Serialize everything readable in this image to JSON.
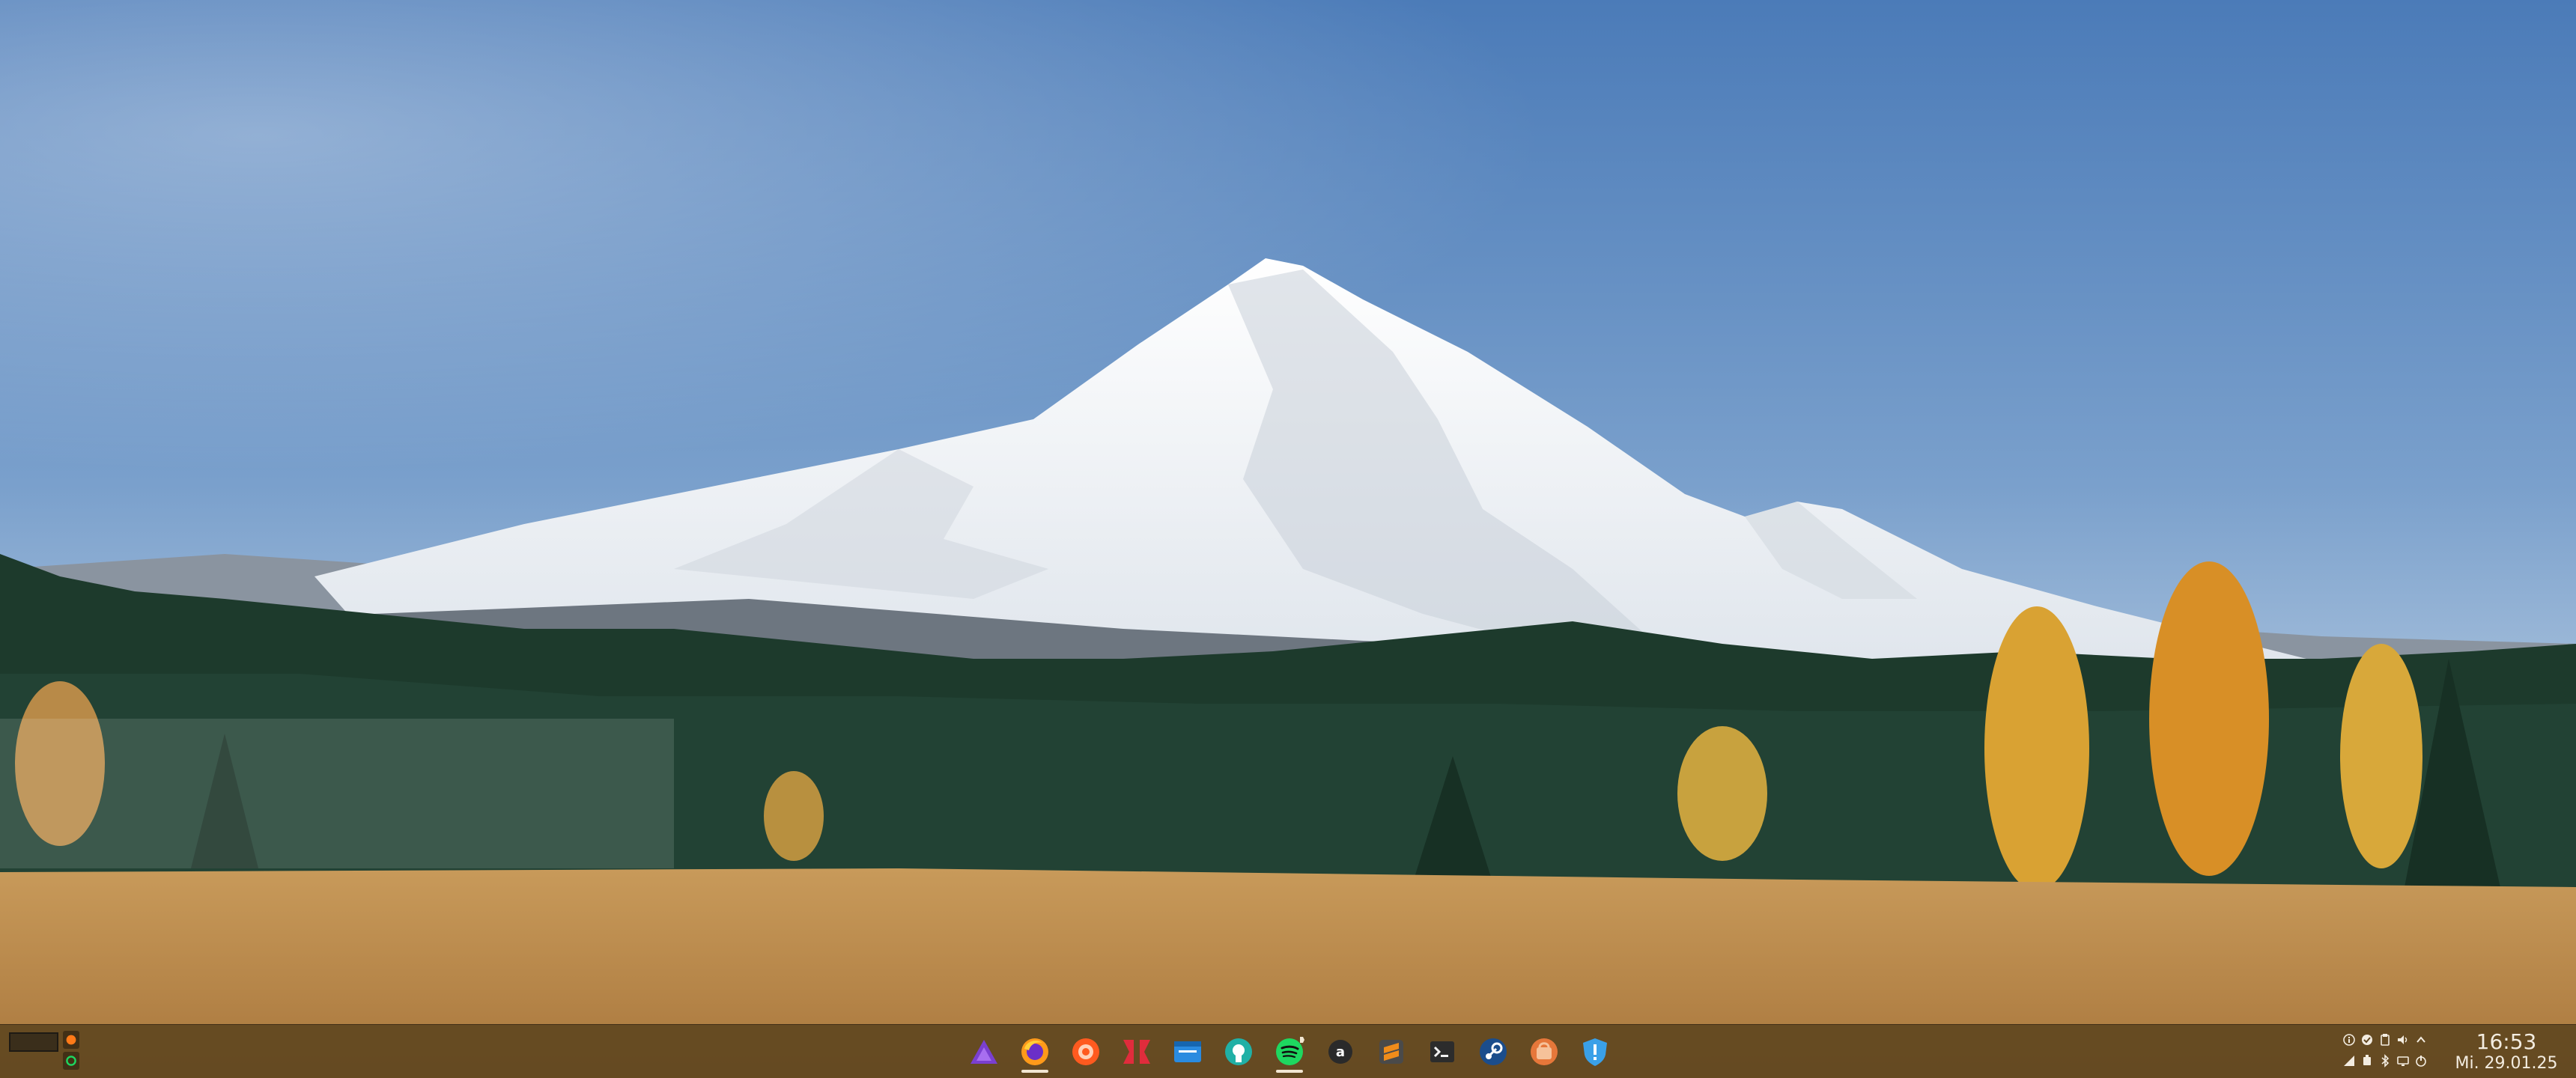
{
  "wallpaper": {
    "description_icon": "mountain-landscape-wallpaper",
    "colors": {
      "sky_top": "#4f7fbd",
      "sky_bottom": "#c8d8e8",
      "snow": "#f4f6f8",
      "forest": "#1f3a2c",
      "meadow": "#b8884a",
      "autumn": "#d89a2a"
    }
  },
  "taskbar": {
    "background": "#604620",
    "pager": {
      "desktops": [
        "desktop-1",
        "desktop-2"
      ]
    },
    "tasks": [
      {
        "icon": "app-launcher-icon",
        "color": "#7a3fd0",
        "active": false
      },
      {
        "icon": "firefox-icon",
        "color": "#ff7a18",
        "active": true
      },
      {
        "icon": "browser-orange-icon",
        "color": "#ff5a1f",
        "active": false
      },
      {
        "icon": "red-mail-icon",
        "color": "#e02c3c",
        "active": false
      },
      {
        "icon": "file-manager-icon",
        "color": "#2a8be0",
        "active": false
      },
      {
        "icon": "github-desktop-icon",
        "color": "#20b0a6",
        "active": false
      },
      {
        "icon": "spotify-icon",
        "color": "#1ed760",
        "active": true
      },
      {
        "icon": "amazon-icon",
        "color": "#2a2a2a",
        "active": false
      },
      {
        "icon": "sublime-text-icon",
        "color": "#f08c1a",
        "active": false
      },
      {
        "icon": "terminal-icon",
        "color": "#2c2c2c",
        "active": false
      },
      {
        "icon": "steam-icon",
        "color": "#1b4d8c",
        "active": false
      },
      {
        "icon": "ubuntu-software-icon",
        "color": "#e6773a",
        "active": false
      },
      {
        "icon": "vpn-shield-icon",
        "color": "#3aa0e8",
        "active": false
      }
    ],
    "tray": [
      "info-icon",
      "checkmark-icon",
      "clipboard-icon",
      "volume-icon",
      "expand-arrow-icon",
      "network-icon",
      "usb-drive-icon",
      "bluetooth-icon",
      "display-icon",
      "power-icon"
    ],
    "clock": {
      "time": "16:53",
      "date": "Mi. 29.01.25"
    }
  }
}
